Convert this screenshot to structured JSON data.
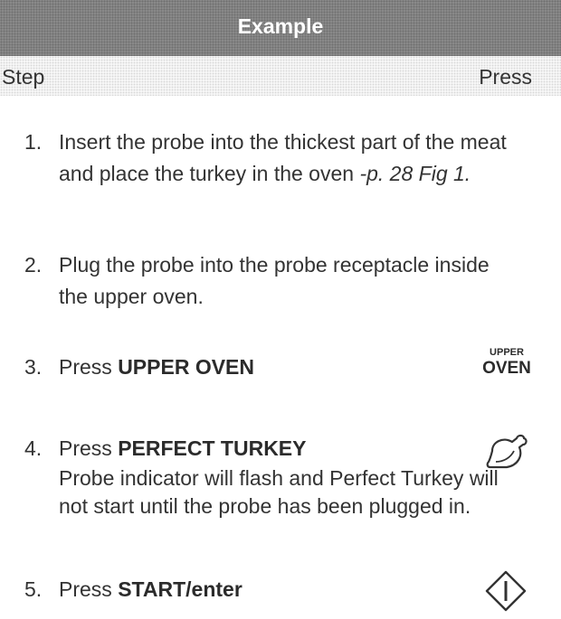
{
  "header": {
    "title": "Example"
  },
  "columns": {
    "step": "Step",
    "press": "Press"
  },
  "steps": [
    {
      "num": "1.",
      "text": "Insert the probe into the thickest part of the meat and place the turkey in the oven ",
      "ref": "-p. 28 Fig 1."
    },
    {
      "num": "2.",
      "text": "Plug the probe into the probe receptacle inside the upper oven."
    },
    {
      "num": "3.",
      "prefix": "Press ",
      "bold": "UPPER OVEN"
    },
    {
      "num": "4.",
      "prefix": "Press ",
      "bold": "PERFECT TURKEY",
      "note": "Probe indicator will flash and Perfect Turkey will not start until the probe has been plugged in."
    },
    {
      "num": "5.",
      "prefix": "Press ",
      "bold": "START/enter"
    }
  ],
  "buttons": {
    "upper_oven": {
      "line1": "UPPER",
      "line2": "OVEN"
    },
    "turkey": {
      "icon": "turkey-icon"
    },
    "start": {
      "icon": "start-enter-icon"
    }
  }
}
